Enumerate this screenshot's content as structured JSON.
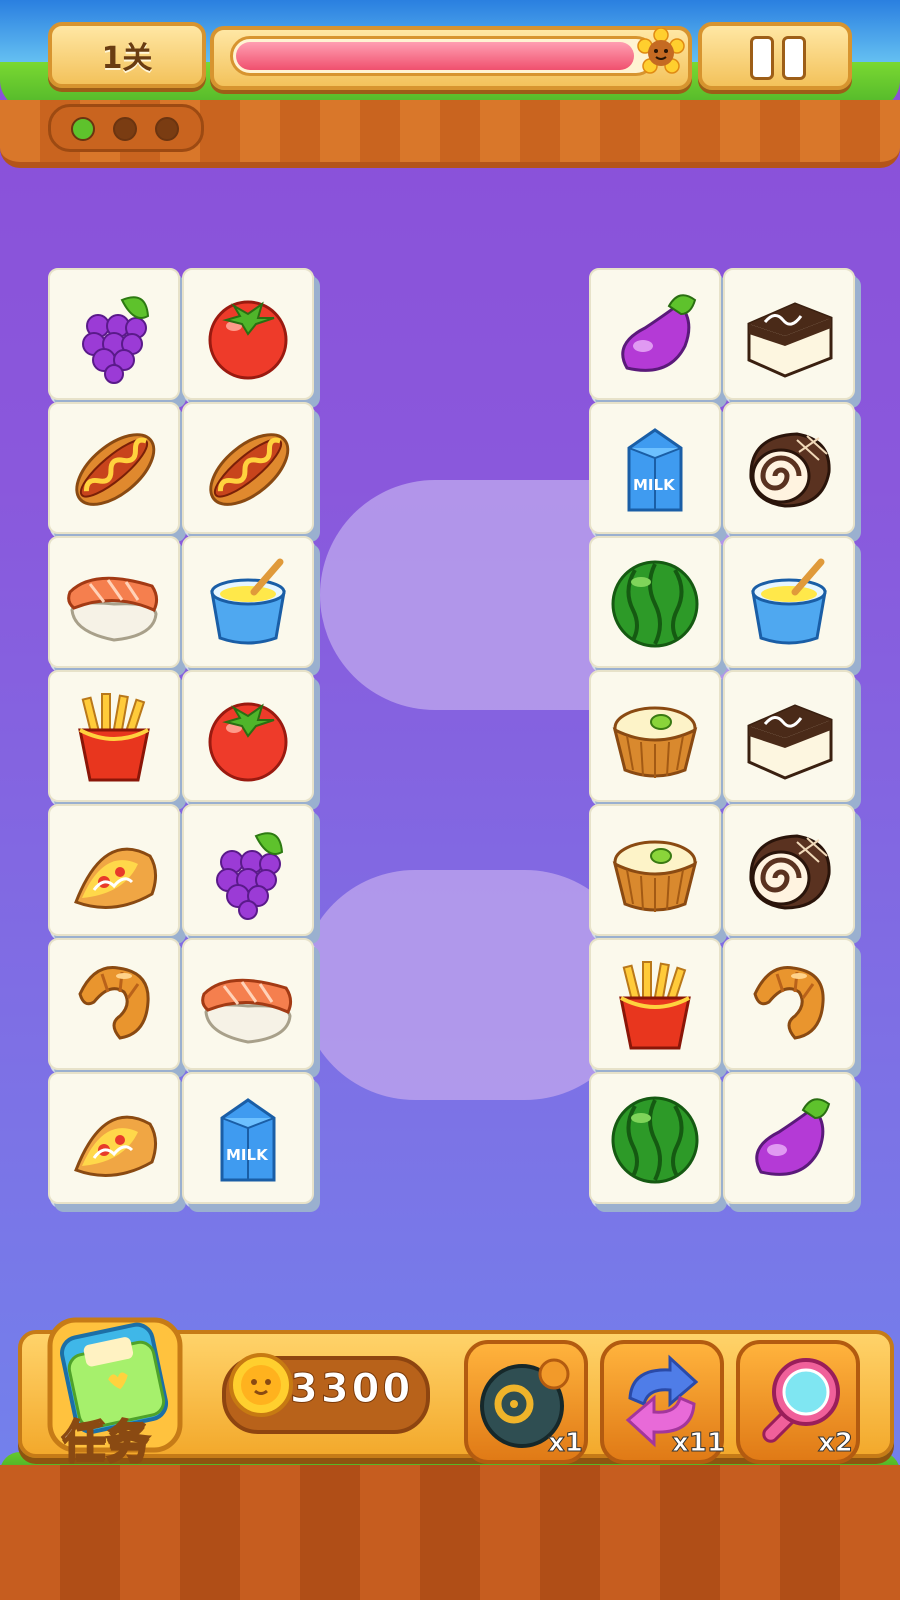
{
  "header": {
    "level_label": "1关",
    "progress": 0.97,
    "level_dots": [
      {
        "state": "active",
        "color": "#5ec22c"
      },
      {
        "state": "inactive",
        "color": "#7a3c12"
      },
      {
        "state": "inactive",
        "color": "#7a3c12"
      }
    ]
  },
  "board": {
    "left_grid": [
      [
        "grapes",
        "tomato"
      ],
      [
        "hot-dog",
        "hot-dog"
      ],
      [
        "salmon-sushi",
        "pudding-cup"
      ],
      [
        "french-fries",
        "tomato"
      ],
      [
        "pizza-slice",
        "grapes"
      ],
      [
        "croissant",
        "salmon-sushi"
      ],
      [
        "pizza-slice",
        "milk-carton"
      ]
    ],
    "right_grid": [
      [
        "eggplant",
        "cream-cake"
      ],
      [
        "milk-carton",
        "swiss-roll"
      ],
      [
        "watermelon",
        "pudding-cup"
      ],
      [
        "tart",
        "cream-cake"
      ],
      [
        "tart",
        "swiss-roll"
      ],
      [
        "french-fries",
        "croissant"
      ],
      [
        "watermelon",
        "eggplant"
      ]
    ],
    "milk_text": "MILK"
  },
  "bottom": {
    "task_label": "任务",
    "coins": "3300",
    "tools": [
      {
        "icon": "bomb-icon",
        "count": "x1"
      },
      {
        "icon": "shuffle-icon",
        "count": "x11"
      },
      {
        "icon": "magnifier-icon",
        "count": "x2"
      }
    ]
  },
  "colors": {
    "accent": "#f0506e",
    "board_bg": "#8a58dc",
    "tile": "#fbf9ec"
  }
}
